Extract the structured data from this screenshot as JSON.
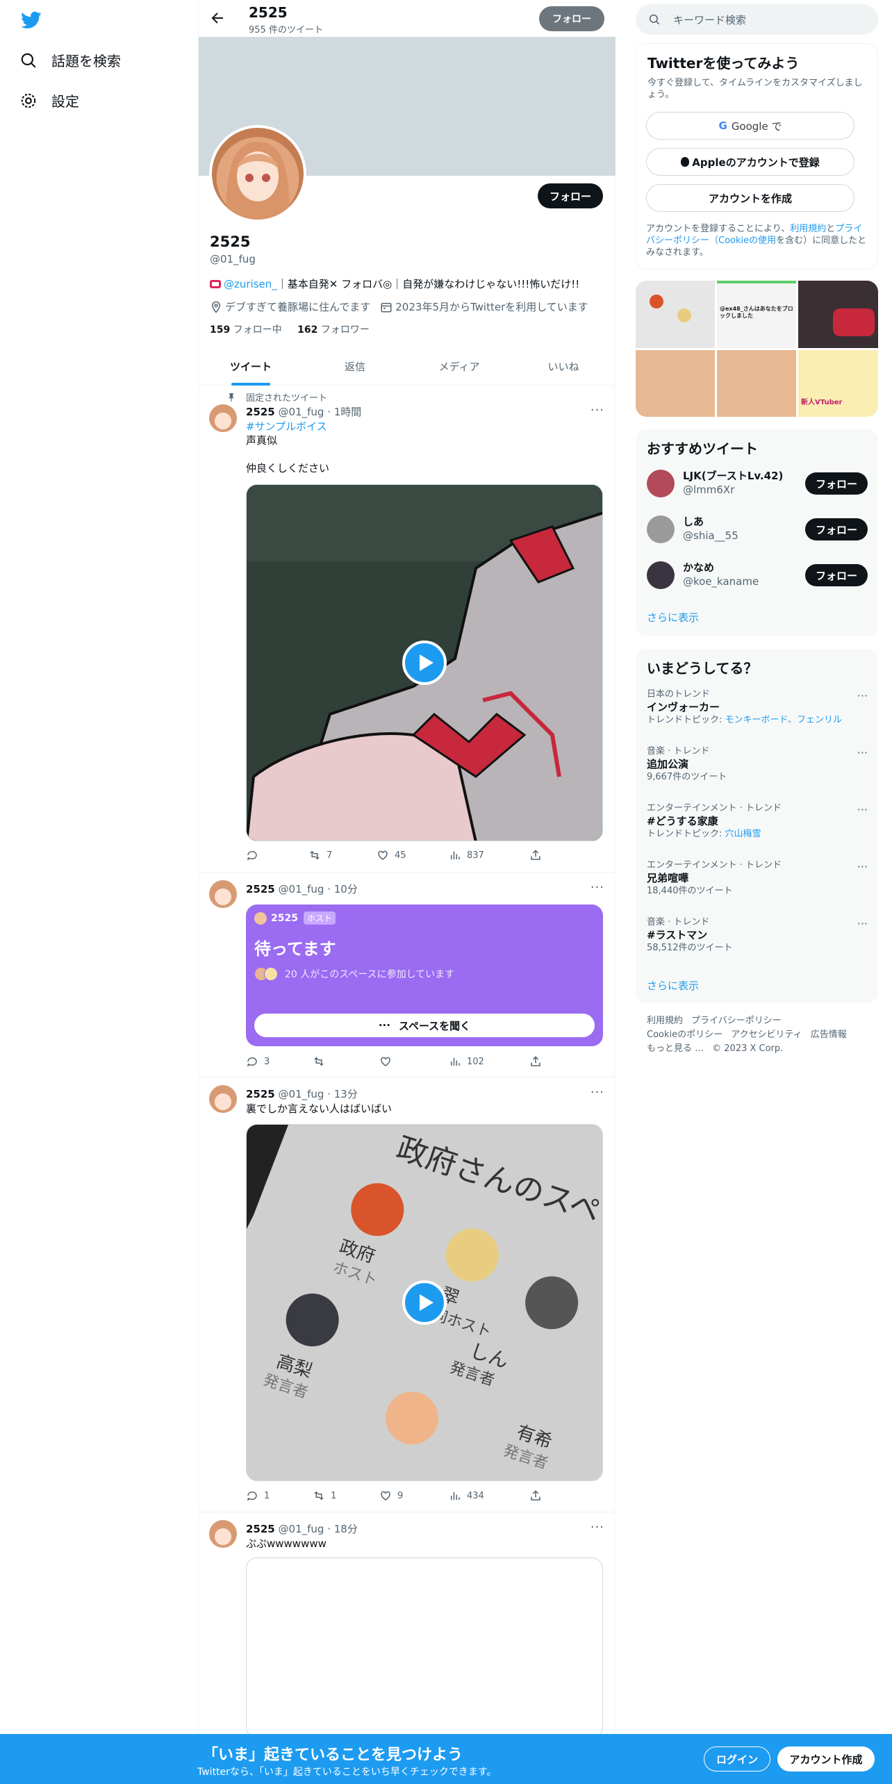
{
  "nav": {
    "search_label": "話題を検索",
    "settings_label": "設定"
  },
  "profile": {
    "name": "2525",
    "tweet_count": "955 件のツイート",
    "follow_label": "フォロー",
    "handle": "@01_fug",
    "bio_link": "@zurisen_",
    "bio_rest": "｜基本自発✕ フォロバ◎｜自発が嫌なわけじゃない!!!怖いだけ!!",
    "location": "デブすぎて養豚場に住んでます",
    "joined": "2023年5月からTwitterを利用しています",
    "following_count": "159",
    "following_label": "フォロー中",
    "followers_count": "162",
    "followers_label": "フォロワー"
  },
  "tabs": [
    "ツイート",
    "返信",
    "メディア",
    "いいね"
  ],
  "tweets": [
    {
      "pinned": "固定されたツイート",
      "name": "2525",
      "meta": "@01_fug · 1時間",
      "hashtag": "#サンプルボイス",
      "text": "声真似\n\n仲良くしください",
      "replies": "",
      "retweets": "7",
      "likes": "45",
      "views": "837"
    },
    {
      "name": "2525",
      "meta": "@01_fug · 10分",
      "space_host": "2525",
      "space_host_badge": "ホスト",
      "space_title": "待ってます",
      "space_listeners": "20 人がこのスペースに参加しています",
      "space_button": "スペースを聞く",
      "replies": "3",
      "retweets": "",
      "likes": "",
      "views": "102"
    },
    {
      "name": "2525",
      "meta": "@01_fug · 13分",
      "text": "裏でしか言えない人はばいばい",
      "replies": "1",
      "retweets": "1",
      "likes": "9",
      "views": "434",
      "image_labels": {
        "heading": "政府さんのスペース",
        "host_name": "政府",
        "host_role": "ホスト",
        "co_name": "翠",
        "co_role": "共同ホスト",
        "s1_name": "しん",
        "s1_role": "発言者",
        "s2_name": "高梨",
        "s2_role": "発言者",
        "s3_name": "有希",
        "s3_role": "発言者"
      }
    },
    {
      "name": "2525",
      "meta": "@01_fug · 18分",
      "text": "ぷぷwwwwwww"
    }
  ],
  "sidebar": {
    "search_placeholder": "キーワード検索",
    "signup": {
      "title": "Twitterを使ってみよう",
      "subtitle": "今すぐ登録して、タイムラインをカスタマイズしましょう。",
      "google": "Google で",
      "apple": "Appleのアカウントで登録",
      "create": "アカウントを作成",
      "terms_pre": "アカウントを登録することにより、",
      "terms_link1": "利用規約",
      "terms_mid": "と",
      "terms_link2": "プライバシーポリシー",
      "terms_link3": "（Cookieの使用",
      "terms_post": "を含む）に同意したとみなされます。"
    },
    "photo_texts": {
      "p2_title": "@ex48_さんはあなたをブロックしました",
      "p6_text": "新人VTuber"
    },
    "recommend": {
      "title": "おすすめツイート",
      "users": [
        {
          "name": "LJK(ブーストLv.42)",
          "handle": "@lmm6Xr",
          "color": "#b24a5a"
        },
        {
          "name": "しあ",
          "handle": "@shia__55",
          "color": "#9a9a9a"
        },
        {
          "name": "かなめ",
          "handle": "@koe_kaname",
          "color": "#3a3440"
        }
      ],
      "follow_label": "フォロー",
      "more": "さらに表示"
    },
    "trends": {
      "title": "いまどうしてる？",
      "items": [
        {
          "cat": "日本のトレンド",
          "title": "インヴォーカー",
          "count": "",
          "topic_label": "トレンドトピック: ",
          "topic": "モンキーボード、フェンリル"
        },
        {
          "cat": "音楽 · トレンド",
          "title": "追加公演",
          "count": "9,667件のツイート"
        },
        {
          "cat": "エンターテインメント · トレンド",
          "title": "#どうする家康",
          "count": "",
          "topic_label": "トレンドトピック: ",
          "topic": "穴山梅雪"
        },
        {
          "cat": "エンターテインメント · トレンド",
          "title": "兄弟喧嘩",
          "count": "18,440件のツイート"
        },
        {
          "cat": "音楽 · トレンド",
          "title": "#ラストマン",
          "count": "58,512件のツイート"
        }
      ],
      "more": "さらに表示"
    },
    "footer_links": {
      "l1": "利用規約",
      "l2": "プライバシーポリシー",
      "l3": "Cookieのポリシー",
      "l4": "アクセシビリティ",
      "l5": "広告情報",
      "l6": "もっと見る …",
      "l7": "© 2023 X Corp."
    }
  },
  "bottom_bar": {
    "title": "「いま」起きていることを見つけよう",
    "subtitle": "Twitterなら、「いま」起きていることをいち早くチェックできます。",
    "login": "ログイン",
    "signup": "アカウント作成"
  },
  "colors": {
    "accent": "#1d9bf0",
    "space": "#9b6bf2",
    "text": "#0f1419",
    "muted": "#536471"
  }
}
